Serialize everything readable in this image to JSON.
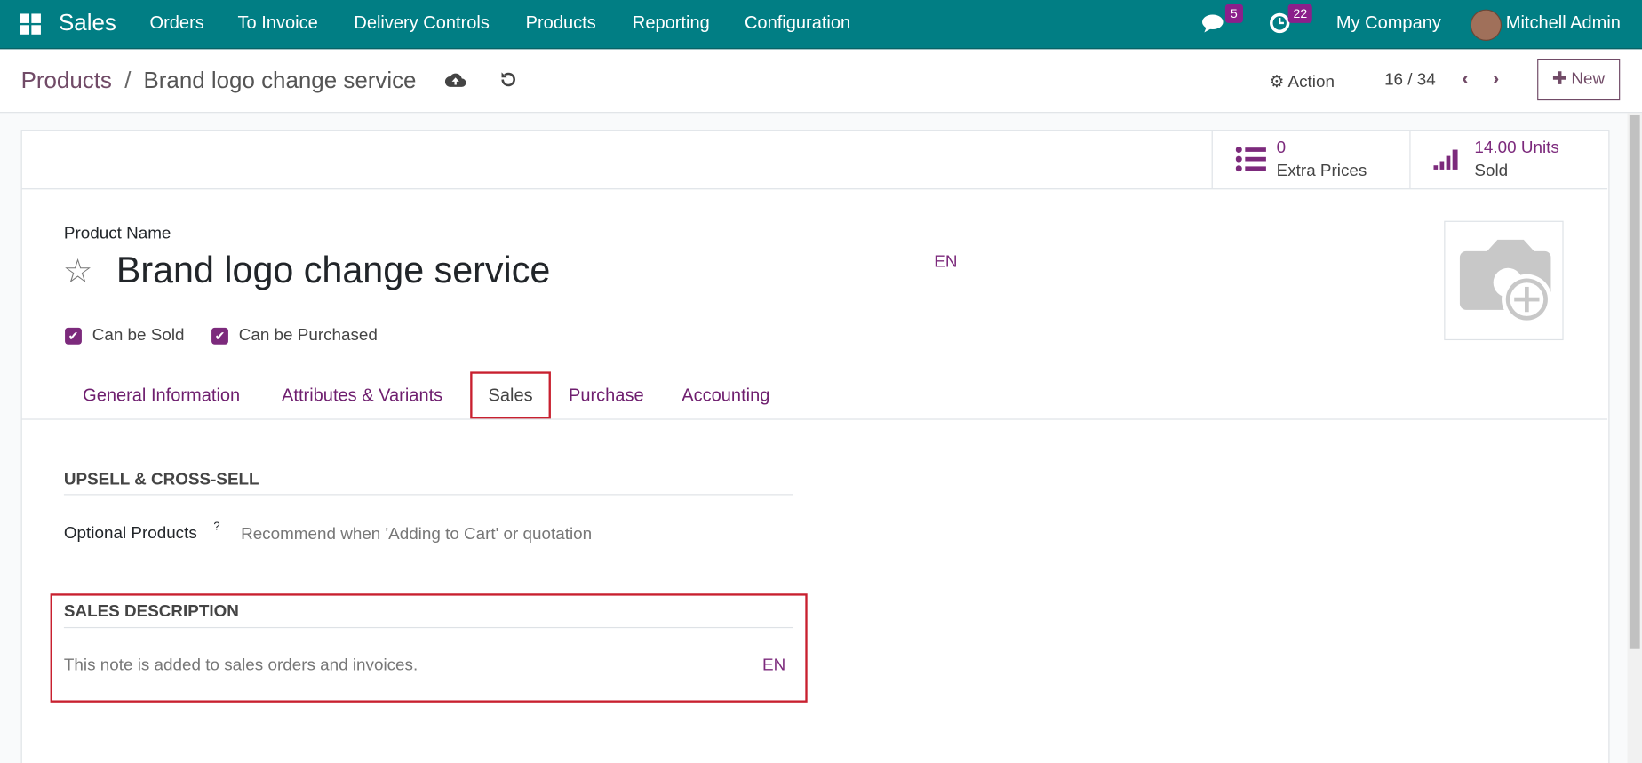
{
  "navbar": {
    "app": "Sales",
    "menu": [
      "Orders",
      "To Invoice",
      "Delivery Controls",
      "Products",
      "Reporting",
      "Configuration"
    ],
    "messages_count": "5",
    "activities_count": "22",
    "company": "My Company",
    "user": "Mitchell Admin"
  },
  "control": {
    "breadcrumb_parent": "Products",
    "breadcrumb_sep": "/",
    "breadcrumb_current": "Brand logo change service",
    "action": "Action",
    "pager": "16 / 34",
    "new": "New"
  },
  "stats": {
    "extra_prices_value": "0",
    "extra_prices_label": "Extra Prices",
    "sold_value": "14.00 Units",
    "sold_label": "Sold"
  },
  "form": {
    "name_label": "Product Name",
    "name": "Brand logo change service",
    "lang": "EN",
    "can_be_sold": "Can be Sold",
    "can_be_purchased": "Can be Purchased",
    "tabs": [
      "General Information",
      "Attributes & Variants",
      "Sales",
      "Purchase",
      "Accounting"
    ],
    "upsell_header": "UPSELL & CROSS-SELL",
    "optional_label": "Optional Products",
    "help": "?",
    "optional_placeholder": "Recommend when 'Adding to Cart' or quotation",
    "sales_desc_header": "SALES DESCRIPTION",
    "sales_desc_placeholder": "This note is added to sales orders and invoices.",
    "sales_desc_lang": "EN"
  },
  "colors": {
    "navbar": "#017e84",
    "accent": "#714b67",
    "highlight": "#c8202f"
  }
}
